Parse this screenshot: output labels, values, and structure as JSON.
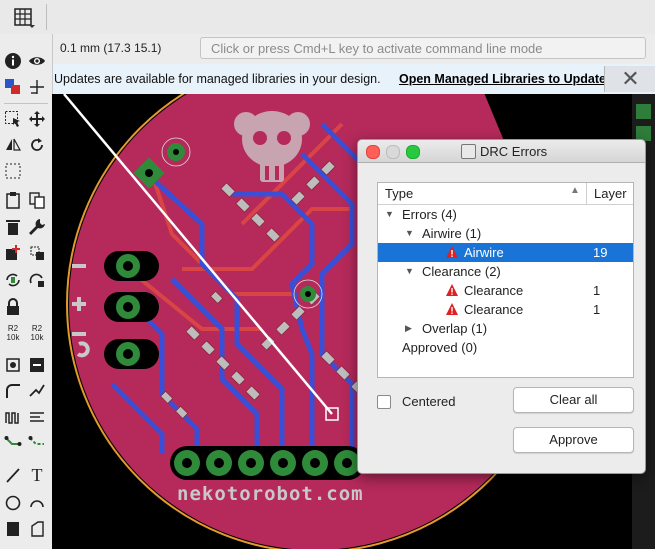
{
  "toolbar": {
    "grid_icon": "grid-icon"
  },
  "coordinates": {
    "readout": "0.1 mm (17.3 15.1)"
  },
  "command_line": {
    "placeholder": "Click or press Cmd+L key to activate command line mode"
  },
  "update_banner": {
    "text": "Updates are available for managed libraries in your design.",
    "link": "Open Managed Libraries to Update",
    "close_glyph": "✕"
  },
  "sidebar": {
    "tools": [
      "info-icon",
      "eye-icon",
      "layer-icon",
      "mark-icon",
      "select-icon",
      "move-icon",
      "mirror-icon",
      "rotate-icon",
      "group-icon",
      "paste-icon",
      "copy-icon",
      "properties-icon",
      "delete-icon",
      "wrench-icon",
      "add-icon",
      "replace-icon",
      "swap-icon",
      "change-icon",
      "lock-icon",
      "optimize-icon",
      "value-icon",
      "name-icon",
      "miter-icon",
      "split-icon",
      "meander-icon",
      "smash-icon",
      "route-icon",
      "ripup-icon",
      "wire-icon",
      "text-icon",
      "circle-icon",
      "arc-icon",
      "rect-icon",
      "polygon-icon"
    ],
    "value_labels": [
      "R2 10k",
      "R2 10k"
    ]
  },
  "board": {
    "silk_text": "nekotorobot.com",
    "colors": {
      "board": "#b52a5b",
      "top_copper": "#c63a45",
      "bottom_copper": "#3b4fd6",
      "pad": "#2f8b3a",
      "silk": "#c8c8c8",
      "outline": "#e39a2c"
    }
  },
  "drc_dialog": {
    "title": "DRC Errors",
    "columns": {
      "type": "Type",
      "layer": "Layer"
    },
    "tree": [
      {
        "label": "Errors (4)",
        "level": 0,
        "expanded": true
      },
      {
        "label": "Airwire (1)",
        "level": 1,
        "expanded": true
      },
      {
        "label": "Airwire",
        "level": 2,
        "layer": "19",
        "selected": true
      },
      {
        "label": "Clearance (2)",
        "level": 1,
        "expanded": true
      },
      {
        "label": "Clearance",
        "level": 2,
        "layer": "1"
      },
      {
        "label": "Clearance",
        "level": 2,
        "layer": "1"
      },
      {
        "label": "Overlap (1)",
        "level": 1,
        "expanded": false
      },
      {
        "label": "Approved (0)",
        "level": 0
      }
    ],
    "centered_label": "Centered",
    "centered_checked": false,
    "clear_all_label": "Clear all",
    "approve_label": "Approve"
  }
}
